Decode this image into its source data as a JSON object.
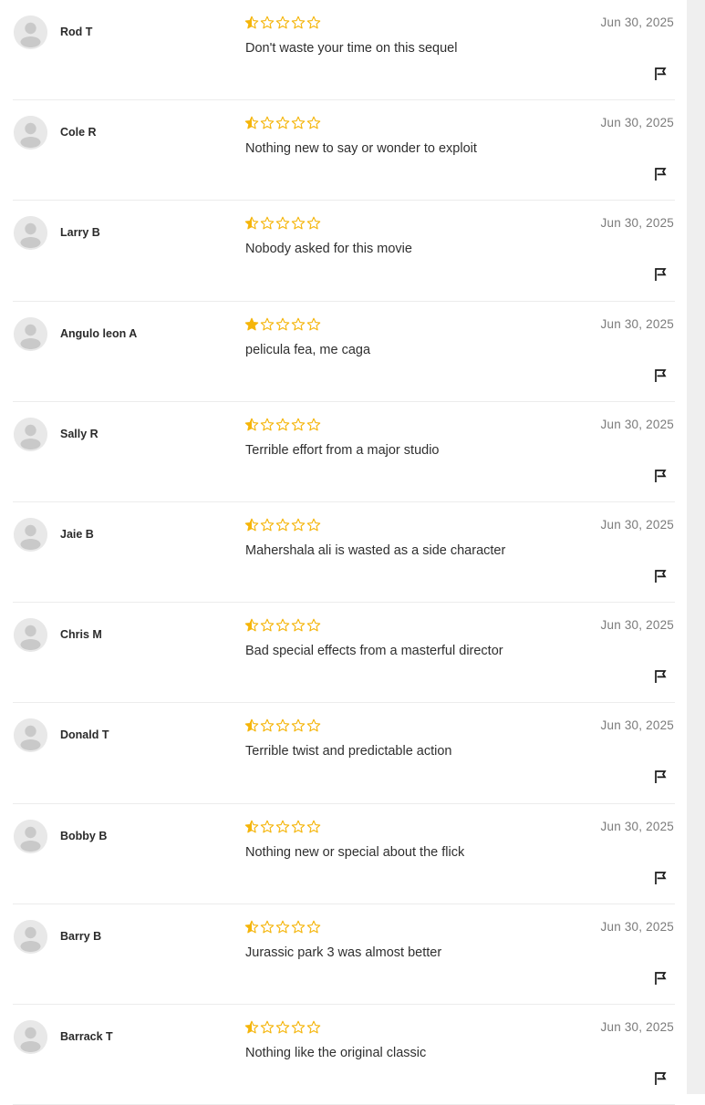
{
  "colors": {
    "star_fill": "#f5b50a",
    "star_outline": "#f5b50a",
    "avatar_bg": "#e8e8e8",
    "avatar_figure": "#c9c9c9"
  },
  "icons": {
    "avatar": "user-silhouette-icon",
    "report": "flag-icon",
    "star_full": "star-filled-icon",
    "star_half": "star-half-icon",
    "star_empty": "star-outline-icon"
  },
  "rating_max": 5,
  "reviews": [
    {
      "name": "Rod T",
      "rating": 0.5,
      "date": "Jun 30, 2025",
      "text": "Don't waste your time on this sequel"
    },
    {
      "name": "Cole R",
      "rating": 0.5,
      "date": "Jun 30, 2025",
      "text": "Nothing new to say or wonder to exploit"
    },
    {
      "name": "Larry B",
      "rating": 0.5,
      "date": "Jun 30, 2025",
      "text": "Nobody asked for this movie"
    },
    {
      "name": "Angulo leon A",
      "rating": 1,
      "date": "Jun 30, 2025",
      "text": "pelicula fea, me caga"
    },
    {
      "name": "Sally R",
      "rating": 0.5,
      "date": "Jun 30, 2025",
      "text": "Terrible effort from a major studio"
    },
    {
      "name": "Jaie B",
      "rating": 0.5,
      "date": "Jun 30, 2025",
      "text": "Mahershala ali is wasted as a side character"
    },
    {
      "name": "Chris M",
      "rating": 0.5,
      "date": "Jun 30, 2025",
      "text": "Bad special effects from a masterful director"
    },
    {
      "name": "Donald T",
      "rating": 0.5,
      "date": "Jun 30, 2025",
      "text": "Terrible twist and predictable action"
    },
    {
      "name": "Bobby B",
      "rating": 0.5,
      "date": "Jun 30, 2025",
      "text": "Nothing new or special about the flick"
    },
    {
      "name": "Barry B",
      "rating": 0.5,
      "date": "Jun 30, 2025",
      "text": "Jurassic park 3 was almost better"
    },
    {
      "name": "Barrack T",
      "rating": 0.5,
      "date": "Jun 30, 2025",
      "text": "Nothing like the original classic"
    }
  ]
}
